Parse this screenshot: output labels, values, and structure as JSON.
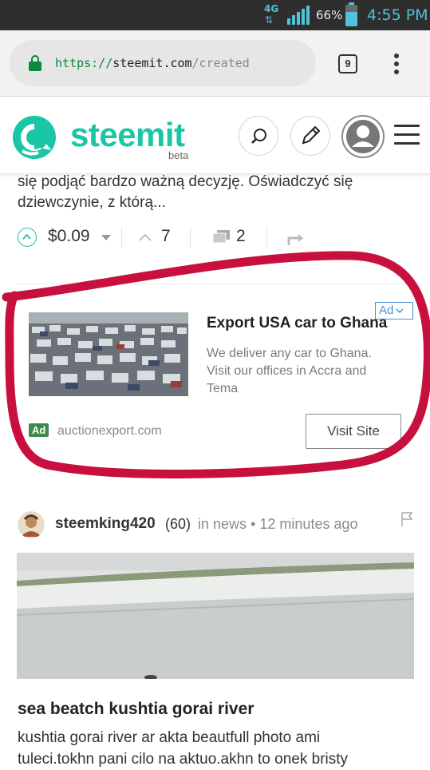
{
  "status_bar": {
    "network": "4G",
    "network_arrows": "⇅",
    "battery_percent": "66%",
    "battery_level": 0.66,
    "time": "4:55 PM"
  },
  "browser": {
    "url_scheme": "https://",
    "url_host": "steemit.com",
    "url_path": "/created",
    "tab_count": "9"
  },
  "site_header": {
    "brand": "steemit",
    "badge": "beta",
    "icons": [
      "steemit-logo-icon",
      "search-icon",
      "pencil-icon",
      "user-avatar-icon",
      "menu-icon"
    ]
  },
  "prev_post": {
    "snippet_line1": "się podjąć bardzo ważną decyzję. Oświadczyć się",
    "snippet_line2": "dziewczynie, z którą...",
    "payout": "$0.09",
    "votes": "7",
    "comments": "2"
  },
  "ad": {
    "title": "Export USA car to Ghana",
    "badge": "Ad",
    "description": "We deliver any car to Ghana. Visit our offices in Accra and Tema",
    "tag": "Ad",
    "domain": "auctionexport.com",
    "cta": "Visit Site",
    "annotation_color": "#c8103f"
  },
  "post": {
    "author": "steemking420",
    "reputation": "(60)",
    "category_prefix": "in",
    "category": "news",
    "separator": "•",
    "time_ago": "12 minutes ago",
    "title": "sea beatch kushtia gorai river",
    "body_line1": "kushtia gorai river ar akta beautfull photo ami",
    "body_line2": "tuleci.tokhn pani cilo na aktuo.akhn to onek bristy"
  },
  "colors": {
    "brand": "#1ac6a5",
    "status_accent": "#4fc3d9",
    "ad_green": "#3f8a4a",
    "ad_blue": "#4a90d9"
  }
}
